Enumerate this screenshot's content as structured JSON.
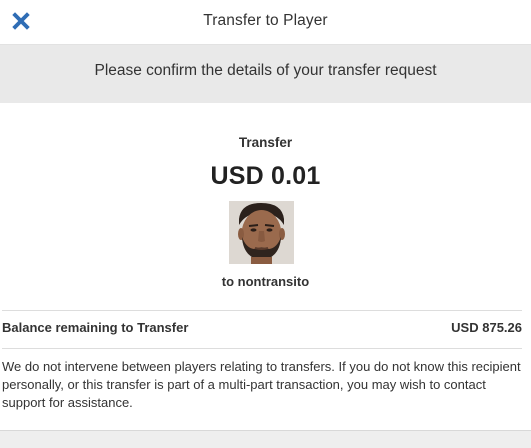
{
  "header": {
    "title": "Transfer to Player",
    "close_icon": "close-icon"
  },
  "confirm_message": "Please confirm the details of your transfer request",
  "transfer": {
    "label": "Transfer",
    "amount": "USD 0.01",
    "recipient": "to nontransito",
    "avatar_icon": "user-avatar"
  },
  "balance": {
    "label": "Balance remaining to Transfer",
    "value": "USD 875.26"
  },
  "notice": "We do not intervene between players relating to transfers. If you do not know this recipient personally, or this transfer is part of a multi-part transaction, you may wish to contact support for assistance.",
  "colors": {
    "accent": "#2f6db5",
    "confirm_bar_bg": "#e9e9e9"
  }
}
